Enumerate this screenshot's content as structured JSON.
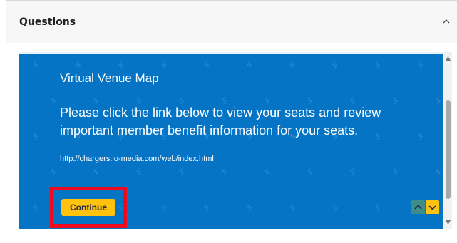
{
  "panel": {
    "title": "Questions",
    "toggle_icon": "chevron-up-icon"
  },
  "survey": {
    "heading": "Virtual Venue Map",
    "body": "Please click the link below to view your seats and review important member benefit information for your seats.",
    "link_text": "http://chargers.io-media.com/web/index.html",
    "continue_label": "Continue",
    "nav_up_icon": "chevron-up-icon",
    "nav_down_icon": "chevron-down-icon",
    "background_color": "#0674c5",
    "accent_color": "#ffc20e",
    "highlight_color": "#ee0b1d",
    "background_pattern_icon": "lightning-bolt-icon"
  },
  "scrollbar": {
    "up_icon": "scroll-up-arrow-icon",
    "down_icon": "scroll-down-arrow-icon"
  }
}
